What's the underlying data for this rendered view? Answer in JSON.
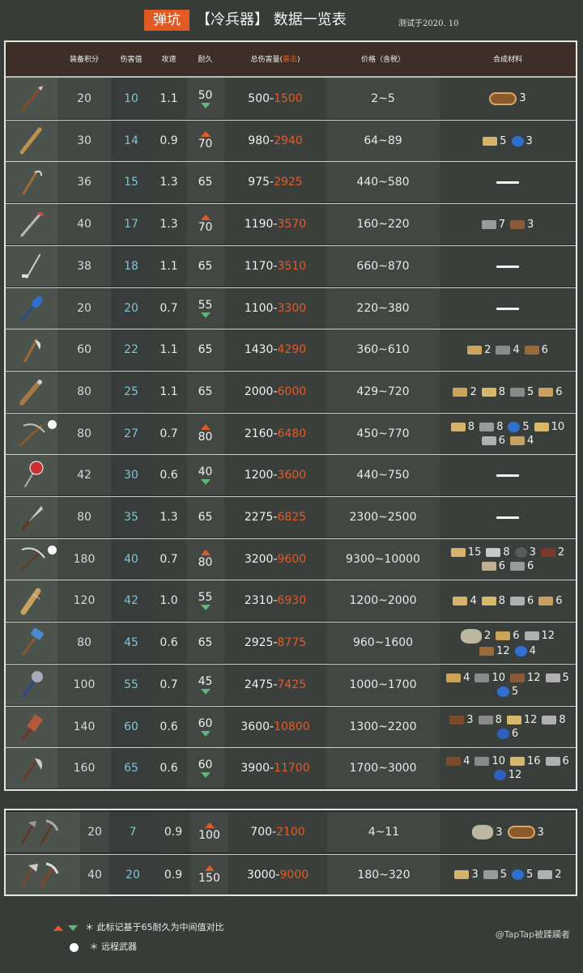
{
  "header": {
    "badge": "弹坑",
    "title": "【冷兵器】 数据一览表",
    "tested": "测试于2020. 10"
  },
  "columns": {
    "score": "装备积分",
    "damage": "伤害值",
    "speed": "攻速",
    "durability": "耐久",
    "total_prefix": "总伤害量(",
    "total_crit": "暴击",
    "total_suffix": ")",
    "price": "价格（含税）",
    "materials": "合成材料"
  },
  "weapons": [
    {
      "icon": "primitive-spear-icon",
      "score": "20",
      "damage": "10",
      "speed": "1.1",
      "durability": "50",
      "dur_mark": "down",
      "total_low": "500-",
      "total_high": "1500",
      "price": "2~5",
      "ranged": false,
      "materials": [
        {
          "icon": "wood-log-icon",
          "color": "#8a5a2a",
          "qty": "3"
        }
      ]
    },
    {
      "icon": "wooden-club-icon",
      "score": "30",
      "damage": "14",
      "speed": "0.9",
      "durability": "70",
      "dur_mark": "up",
      "total_low": "980-",
      "total_high": "2940",
      "price": "64~89",
      "ranged": false,
      "materials": [
        {
          "icon": "plank-icon",
          "color": "#d6b36a",
          "qty": "5"
        },
        {
          "icon": "tape-icon",
          "color": "#2f6fd0",
          "qty": "3"
        }
      ]
    },
    {
      "icon": "bone-hook-icon",
      "score": "36",
      "damage": "15",
      "speed": "1.3",
      "durability": "65",
      "dur_mark": "",
      "total_low": "975-",
      "total_high": "2925",
      "price": "440~580",
      "ranged": false,
      "materials": []
    },
    {
      "icon": "crowbar-icon",
      "score": "40",
      "damage": "17",
      "speed": "1.3",
      "durability": "70",
      "dur_mark": "up",
      "total_low": "1190-",
      "total_high": "3570",
      "price": "160~220",
      "ranged": false,
      "materials": [
        {
          "icon": "metal-bar-icon",
          "color": "#9a9a9a",
          "qty": "7"
        },
        {
          "icon": "leather-icon",
          "color": "#8a5a3a",
          "qty": "3"
        }
      ]
    },
    {
      "icon": "golf-club-icon",
      "score": "38",
      "damage": "18",
      "speed": "1.1",
      "durability": "65",
      "dur_mark": "",
      "total_low": "1170-",
      "total_high": "3510",
      "price": "660~870",
      "ranged": false,
      "materials": []
    },
    {
      "icon": "shovel-icon",
      "score": "20",
      "damage": "20",
      "speed": "0.7",
      "durability": "55",
      "dur_mark": "down",
      "total_low": "1100-",
      "total_high": "3300",
      "price": "220~380",
      "ranged": false,
      "materials": []
    },
    {
      "icon": "bone-axe-icon",
      "score": "60",
      "damage": "22",
      "speed": "1.1",
      "durability": "65",
      "dur_mark": "",
      "total_low": "1430-",
      "total_high": "4290",
      "price": "360~610",
      "ranged": false,
      "materials": [
        {
          "icon": "stick-icon",
          "color": "#c9a45a",
          "qty": "2"
        },
        {
          "icon": "blade-icon",
          "color": "#8a8a8a",
          "qty": "4"
        },
        {
          "icon": "rope-icon",
          "color": "#9a6a3a",
          "qty": "6"
        }
      ]
    },
    {
      "icon": "spiked-club-icon",
      "score": "80",
      "damage": "25",
      "speed": "1.1",
      "durability": "65",
      "dur_mark": "",
      "total_low": "2000-",
      "total_high": "6000",
      "price": "429~720",
      "ranged": false,
      "materials": [
        {
          "icon": "stick-icon",
          "color": "#c9a45a",
          "qty": "2"
        },
        {
          "icon": "bone-icon",
          "color": "#d6b86a",
          "qty": "8"
        },
        {
          "icon": "blade-icon",
          "color": "#8a8a8a",
          "qty": "5"
        },
        {
          "icon": "cloth-icon",
          "color": "#c8a060",
          "qty": "6"
        }
      ]
    },
    {
      "icon": "crossbow-icon",
      "score": "80",
      "damage": "27",
      "speed": "0.7",
      "durability": "80",
      "dur_mark": "up",
      "total_low": "2160-",
      "total_high": "6480",
      "price": "450~770",
      "ranged": true,
      "materials": [
        {
          "icon": "plank-icon",
          "color": "#d6b36a",
          "qty": "8"
        },
        {
          "icon": "metal-bar-icon",
          "color": "#9a9a9a",
          "qty": "8"
        },
        {
          "icon": "tape-icon",
          "color": "#2f6fd0",
          "qty": "5"
        },
        {
          "icon": "bone-icon",
          "color": "#d6b86a",
          "qty": "10"
        },
        {
          "icon": "nails-icon",
          "color": "#b0b0b0",
          "qty": "6"
        },
        {
          "icon": "rope-icon",
          "color": "#c8a060",
          "qty": "4"
        }
      ]
    },
    {
      "icon": "stop-sign-icon",
      "score": "42",
      "damage": "30",
      "speed": "0.6",
      "durability": "40",
      "dur_mark": "down",
      "total_low": "1200-",
      "total_high": "3600",
      "price": "440~750",
      "ranged": false,
      "materials": []
    },
    {
      "icon": "machete-icon",
      "score": "80",
      "damage": "35",
      "speed": "1.3",
      "durability": "65",
      "dur_mark": "",
      "total_low": "2275-",
      "total_high": "6825",
      "price": "2300~2500",
      "ranged": false,
      "materials": []
    },
    {
      "icon": "compound-crossbow-icon",
      "score": "180",
      "damage": "40",
      "speed": "0.7",
      "durability": "80",
      "dur_mark": "up",
      "total_low": "3200-",
      "total_high": "9600",
      "price": "9300~10000",
      "ranged": true,
      "materials": [
        {
          "icon": "plank-icon",
          "color": "#d6b36a",
          "qty": "15"
        },
        {
          "icon": "gun-parts-icon",
          "color": "#c8c8c8",
          "qty": "8"
        },
        {
          "icon": "wheel-icon",
          "color": "#5a5a5a",
          "qty": "3"
        },
        {
          "icon": "handle-icon",
          "color": "#7a3a2a",
          "qty": "2"
        },
        {
          "icon": "gear-icon",
          "color": "#c0b090",
          "qty": "6"
        },
        {
          "icon": "spring-icon",
          "color": "#9a9a9a",
          "qty": "6"
        }
      ]
    },
    {
      "icon": "nail-bat-icon",
      "score": "120",
      "damage": "42",
      "speed": "1.0",
      "durability": "55",
      "dur_mark": "down",
      "total_low": "2310-",
      "total_high": "6930",
      "price": "1200~2000",
      "ranged": false,
      "materials": [
        {
          "icon": "plank-icon",
          "color": "#d6b36a",
          "qty": "4"
        },
        {
          "icon": "bone-icon",
          "color": "#d6b86a",
          "qty": "8"
        },
        {
          "icon": "nails-icon",
          "color": "#b0b0b0",
          "qty": "6"
        },
        {
          "icon": "cloth-icon",
          "color": "#c8a060",
          "qty": "6"
        }
      ]
    },
    {
      "icon": "sledgehammer-icon",
      "score": "80",
      "damage": "45",
      "speed": "0.6",
      "durability": "65",
      "dur_mark": "",
      "total_low": "2925-",
      "total_high": "8775",
      "price": "960~1600",
      "ranged": false,
      "materials": [
        {
          "icon": "stone-icon",
          "color": "#bdb6a0",
          "qty": "2"
        },
        {
          "icon": "stick-icon",
          "color": "#c9a45a",
          "qty": "6"
        },
        {
          "icon": "nails-icon",
          "color": "#b0b0b0",
          "qty": "12"
        },
        {
          "icon": "rope-icon",
          "color": "#9a6a3a",
          "qty": "12"
        },
        {
          "icon": "tape-icon",
          "color": "#2f6fd0",
          "qty": "4"
        }
      ]
    },
    {
      "icon": "mace-icon",
      "score": "100",
      "damage": "55",
      "speed": "0.7",
      "durability": "45",
      "dur_mark": "down",
      "total_low": "2475-",
      "total_high": "7425",
      "price": "1000~1700",
      "ranged": false,
      "materials": [
        {
          "icon": "stick-icon",
          "color": "#c9a45a",
          "qty": "4"
        },
        {
          "icon": "blade-icon",
          "color": "#8a8a8a",
          "qty": "10"
        },
        {
          "icon": "leather-icon",
          "color": "#8a5a3a",
          "qty": "12"
        },
        {
          "icon": "nails-icon",
          "color": "#b0b0b0",
          "qty": "5"
        },
        {
          "icon": "tape-icon",
          "color": "#2f6fd0",
          "qty": "5"
        }
      ]
    },
    {
      "icon": "cleaver-icon",
      "score": "140",
      "damage": "60",
      "speed": "0.6",
      "durability": "60",
      "dur_mark": "down",
      "total_low": "3600-",
      "total_high": "10800",
      "price": "1300~2200",
      "ranged": false,
      "materials": [
        {
          "icon": "handle-icon",
          "color": "#7a4a2a",
          "qty": "3"
        },
        {
          "icon": "blade-icon",
          "color": "#8a8a8a",
          "qty": "8"
        },
        {
          "icon": "bone-icon",
          "color": "#d6b86a",
          "qty": "12"
        },
        {
          "icon": "nails-icon",
          "color": "#b0b0b0",
          "qty": "8"
        },
        {
          "icon": "wire-icon",
          "color": "#3060c0",
          "qty": "6"
        }
      ]
    },
    {
      "icon": "battle-axe-icon",
      "score": "160",
      "damage": "65",
      "speed": "0.6",
      "durability": "60",
      "dur_mark": "down",
      "total_low": "3900-",
      "total_high": "11700",
      "price": "1700~3000",
      "ranged": false,
      "materials": [
        {
          "icon": "handle-icon",
          "color": "#7a4a2a",
          "qty": "4"
        },
        {
          "icon": "blade-icon",
          "color": "#8a8a8a",
          "qty": "10"
        },
        {
          "icon": "bone-icon",
          "color": "#d6b86a",
          "qty": "16"
        },
        {
          "icon": "nails-icon",
          "color": "#b0b0b0",
          "qty": "6"
        },
        {
          "icon": "wire-icon",
          "color": "#3060c0",
          "qty": "12"
        }
      ]
    }
  ],
  "tools": [
    {
      "icon": "stone-axe-and-pickaxe-icon",
      "score": "20",
      "damage": "7",
      "speed": "0.9",
      "durability": "100",
      "dur_mark": "up",
      "total_low": "700-",
      "total_high": "2100",
      "price": "4~11",
      "materials": [
        {
          "icon": "stone-icon",
          "color": "#bdb6a0",
          "qty": "3"
        },
        {
          "icon": "wood-log-icon",
          "color": "#8a5a2a",
          "qty": "3"
        }
      ]
    },
    {
      "icon": "metal-axe-and-pickaxe-icon",
      "score": "40",
      "damage": "20",
      "speed": "0.9",
      "durability": "150",
      "dur_mark": "up",
      "total_low": "3000-",
      "total_high": "9000",
      "price": "180~320",
      "materials": [
        {
          "icon": "plank-icon",
          "color": "#d6b36a",
          "qty": "3"
        },
        {
          "icon": "metal-bar-icon",
          "color": "#9a9a9a",
          "qty": "5"
        },
        {
          "icon": "tape-icon",
          "color": "#2f6fd0",
          "qty": "5"
        },
        {
          "icon": "nails-icon",
          "color": "#b0b0b0",
          "qty": "2"
        }
      ]
    }
  ],
  "legend": {
    "mark_note": "＊ 此标记基于65耐久为中间值对比",
    "ranged_note": "＊ 远程武器"
  },
  "credit": "@TapTap被蹂躏者"
}
